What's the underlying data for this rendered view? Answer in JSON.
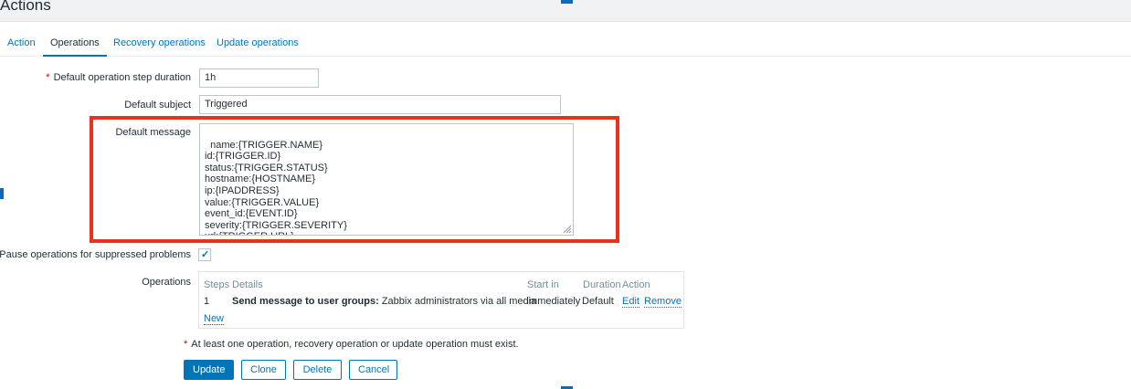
{
  "header": {
    "title": "Actions"
  },
  "tabs": [
    {
      "label": "Action",
      "active": false
    },
    {
      "label": "Operations",
      "active": true
    },
    {
      "label": "Recovery operations",
      "active": false
    },
    {
      "label": "Update operations",
      "active": false
    }
  ],
  "form": {
    "required_mark": "*",
    "step_duration": {
      "label": "Default operation step duration",
      "value": "1h"
    },
    "subject": {
      "label": "Default subject",
      "value": "Triggered"
    },
    "message": {
      "label": "Default message",
      "value": "name:{TRIGGER.NAME}\nid:{TRIGGER.ID}\nstatus:{TRIGGER.STATUS}\nhostname:{HOSTNAME}\nip:{IPADDRESS}\nvalue:{TRIGGER.VALUE}\nevent_id:{EVENT.ID}\nseverity:{TRIGGER.SEVERITY}\nurl:{TRIGGER.URL}"
    },
    "pause": {
      "label": "Pause operations for suppressed problems",
      "checked": true,
      "check_glyph": "✓"
    },
    "operations": {
      "label": "Operations",
      "headers": {
        "steps": "Steps",
        "details": "Details",
        "start_in": "Start in",
        "duration": "Duration",
        "action": "Action"
      },
      "rows": [
        {
          "steps": "1",
          "details_bold": "Send message to user groups:",
          "details_rest": " Zabbix administrators via all media",
          "start_in": "Immediately",
          "duration": "Default",
          "edit": "Edit",
          "remove": "Remove"
        }
      ],
      "new_link": "New"
    },
    "note": "At least one operation, recovery operation or update operation must exist."
  },
  "buttons": {
    "update": "Update",
    "clone": "Clone",
    "delete": "Delete",
    "cancel": "Cancel"
  },
  "colors": {
    "accent": "#0275b8",
    "highlight": "#e8321f",
    "required": "#d40000"
  },
  "icons": {
    "check": "check-icon",
    "resize": "resize-grip-icon"
  }
}
